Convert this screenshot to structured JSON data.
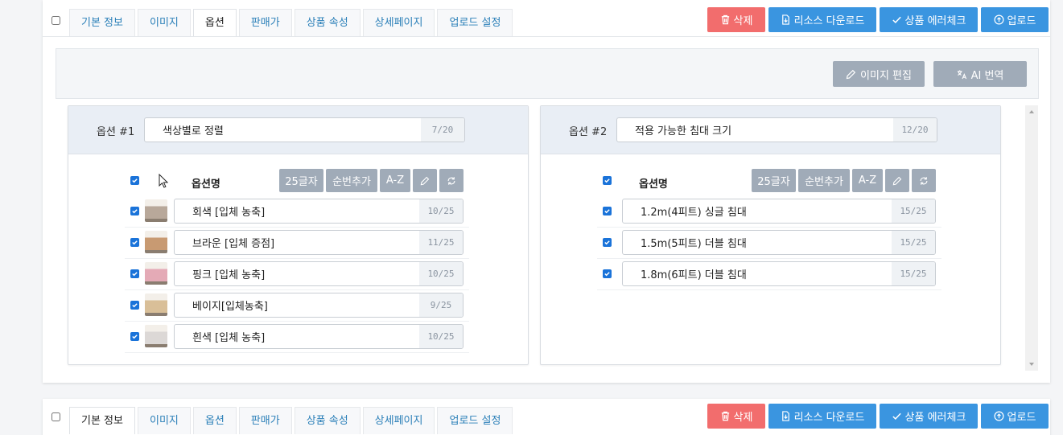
{
  "tabs": [
    "기본 정보",
    "이미지",
    "옵션",
    "판매가",
    "상품 속성",
    "상세페이지",
    "업로드 설정"
  ],
  "card1": {
    "active_tab": 2
  },
  "card2": {
    "active_tab": 0
  },
  "actions": {
    "delete": "삭제",
    "resource_download": "리소스 다운로드",
    "error_check": "상품 에러체크",
    "upload": "업로드"
  },
  "toolbar": {
    "image_edit": "이미지 편집",
    "ai_translate": "AI 번역"
  },
  "option_tools": {
    "chars25": "25글자",
    "seq_add": "순번추가",
    "az": "A-Z"
  },
  "option_name_header": "옵션명",
  "options": [
    {
      "label": "옵션 #1",
      "name": "색상별로 정렬",
      "counter": "7/20",
      "values": [
        {
          "text": "회색 [입체 농축]",
          "counter": "10/25",
          "color": "#b8a89a"
        },
        {
          "text": "브라운 [입체 증점]",
          "counter": "11/25",
          "color": "#c89a72"
        },
        {
          "text": "핑크 [입체 농축]",
          "counter": "10/25",
          "color": "#e4aab6"
        },
        {
          "text": "베이지[입체농축]",
          "counter": "9/25",
          "color": "#d9bf98"
        },
        {
          "text": "흰색 [입체 농축]",
          "counter": "10/25",
          "color": "#dcd8d6"
        }
      ]
    },
    {
      "label": "옵션 #2",
      "name": "적용 가능한 침대 크기",
      "counter": "12/20",
      "values": [
        {
          "text": "1.2m(4피트) 싱글 침대",
          "counter": "15/25"
        },
        {
          "text": "1.5m(5피트) 더블 침대",
          "counter": "15/25"
        },
        {
          "text": "1.8m(6피트) 더블 침대",
          "counter": "15/25"
        }
      ]
    }
  ]
}
